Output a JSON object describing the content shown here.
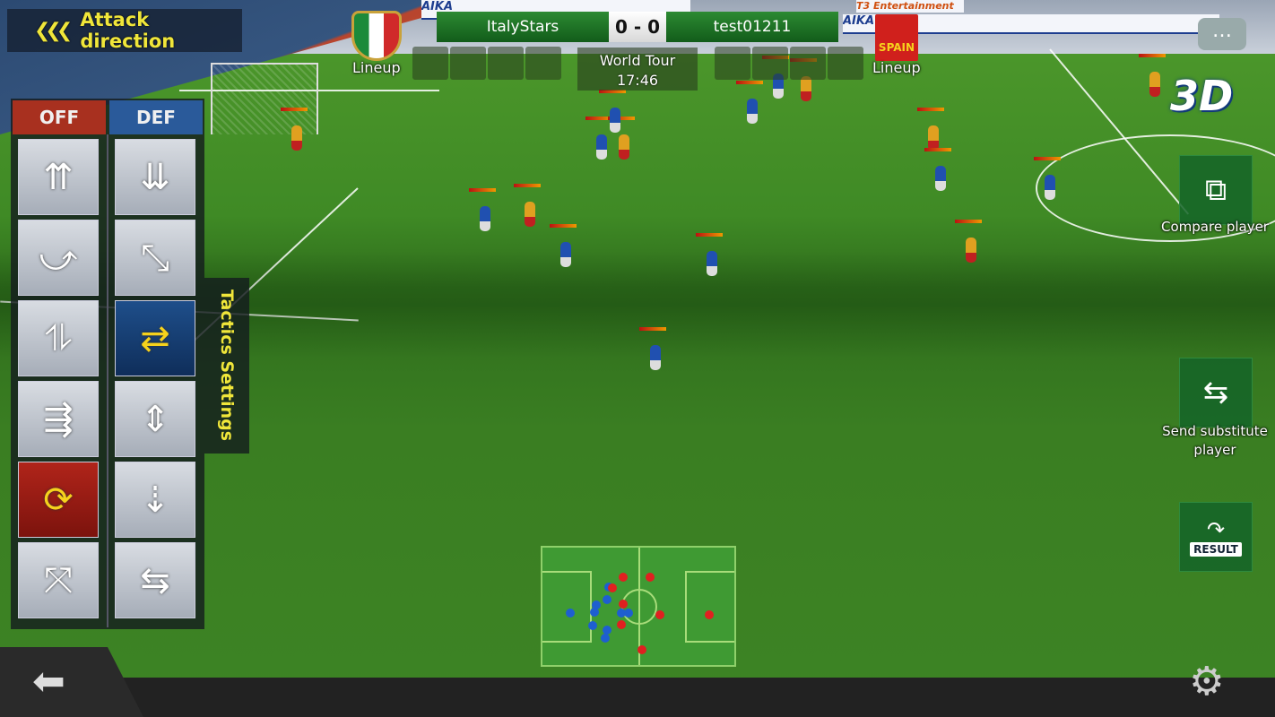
{
  "hud": {
    "attack_direction": {
      "label": "Attack direction",
      "icon": "triple-chevron-left-icon"
    },
    "scoreboard": {
      "home_team": "ItalyStars",
      "away_team": "test01211",
      "score": "0 - 0"
    },
    "match": {
      "mode": "World Tour",
      "clock": "17:46"
    },
    "home_lineup": {
      "label": "Lineup",
      "crest": "italy-flag-crest"
    },
    "away_lineup": {
      "label": "Lineup",
      "crest_text": "SPAIN"
    },
    "view_mode": "3D",
    "ads": [
      "AIKA",
      "AIKA",
      "AIKA",
      "T3 Entertainment"
    ]
  },
  "tactics": {
    "off_label": "OFF",
    "def_label": "DEF",
    "settings_label": "Tactics Settings",
    "off_buttons": [
      {
        "icon": "all-forward-arrows-icon",
        "glyph": "⇈",
        "selected": false
      },
      {
        "icon": "u-turn-arrow-icon",
        "glyph": "⤻",
        "selected": false
      },
      {
        "icon": "split-arrow-icon",
        "glyph": "⥮",
        "selected": false
      },
      {
        "icon": "spread-forward-arrows-icon",
        "glyph": "⇶",
        "selected": false
      },
      {
        "icon": "rotate-swap-icon",
        "glyph": "⟳",
        "selected": true
      },
      {
        "icon": "diverge-arrows-icon",
        "glyph": "⤧",
        "selected": false
      }
    ],
    "def_buttons": [
      {
        "icon": "all-back-arrows-icon",
        "glyph": "⇊",
        "selected": false
      },
      {
        "icon": "compress-arrows-icon",
        "glyph": "⤡",
        "selected": false
      },
      {
        "icon": "horizontal-shift-arrows-icon",
        "glyph": "⇄",
        "selected": true
      },
      {
        "icon": "vertical-both-arrows-icon",
        "glyph": "⇕",
        "selected": false
      },
      {
        "icon": "down-arrows-icon",
        "glyph": "⇣",
        "selected": false
      },
      {
        "icon": "converge-arrows-icon",
        "glyph": "⇆",
        "selected": false
      }
    ]
  },
  "right_actions": {
    "compare": {
      "label": "Compare player",
      "icon": "compare-player-icon"
    },
    "substitute": {
      "label": "Send substitute player",
      "icon": "substitute-icon"
    },
    "result": {
      "label": "RESULT",
      "icon": "result-arrow-icon"
    }
  },
  "colors": {
    "home": "#1e5fd0",
    "away": "#e02020",
    "panel_off": "#b0241a",
    "panel_def": "#2a5a9a",
    "highlight": "#f0e63a"
  }
}
